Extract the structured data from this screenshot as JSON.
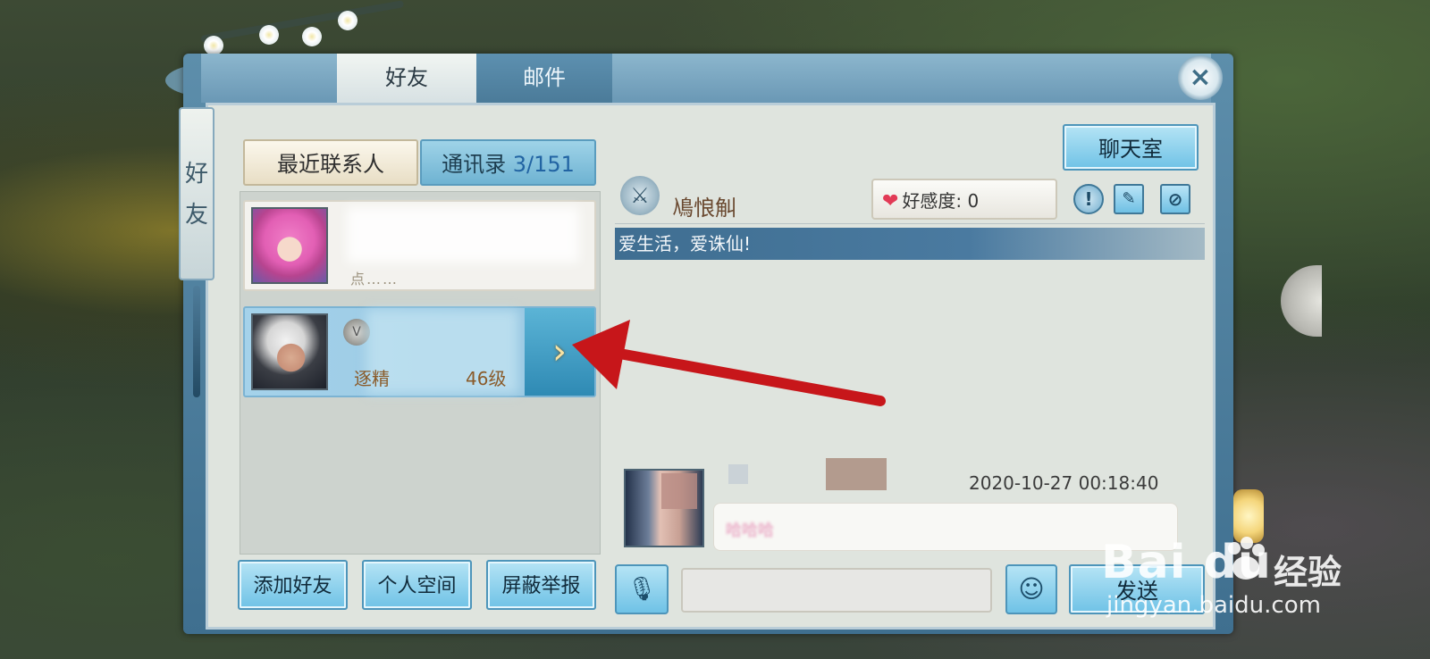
{
  "tabs": {
    "friends": "好友",
    "mail": "邮件"
  },
  "vertical_banner": [
    "好",
    "友"
  ],
  "close_label": "×",
  "subtabs": {
    "recent": "最近联系人",
    "contacts_label": "通讯录",
    "contacts_count": "3/151"
  },
  "friend_list": [
    {
      "hint": "点……"
    },
    {
      "name": "逐精",
      "level": "46级",
      "badge": "V",
      "arrow": "›"
    }
  ],
  "left_buttons": {
    "add": "添加好友",
    "space": "个人空间",
    "report": "屏蔽举报"
  },
  "chatroom_label": "聊天室",
  "profile": {
    "name": "鳰悢觓",
    "favor_label": "好感度: 0",
    "signature": "爱生活，爱诛仙!",
    "icons": [
      "info-icon",
      "edit-icon",
      "block-icon"
    ]
  },
  "message": {
    "timestamp": "2020-10-27 00:18:40",
    "text": "哈哈哈"
  },
  "input_bar": {
    "placeholder": "",
    "send_label": "发送"
  },
  "watermark": {
    "brand": "Bai du",
    "jingyan": "经验",
    "url": "jingyan.baidu.com"
  },
  "colors": {
    "accent_blue": "#6fc2e6",
    "arrow_red": "#c7161a",
    "signature_bar": "#3f6e91"
  }
}
